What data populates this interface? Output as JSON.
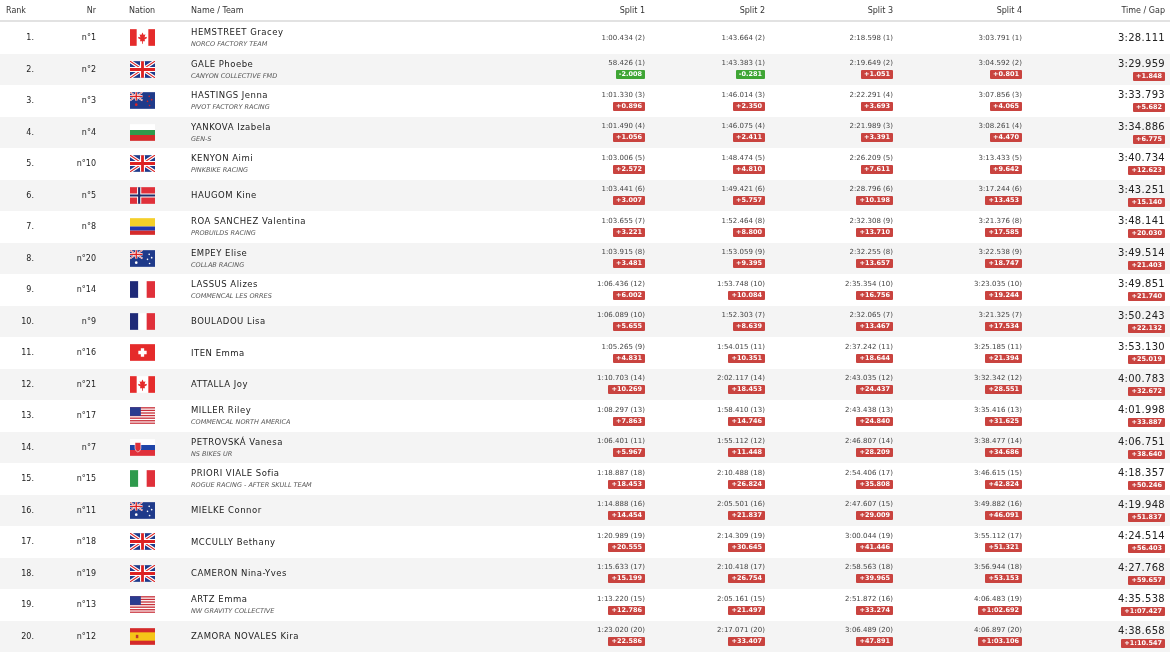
{
  "columns": [
    "Rank",
    "Nr",
    "Nation",
    "Name / Team",
    "Split 1",
    "Split 2",
    "Split 3",
    "Split 4",
    "Time / Gap"
  ],
  "rows": [
    {
      "rank": "1.",
      "nr": "n°1",
      "kind": "ca",
      "name": "HEMSTREET Gracey",
      "team": "NORCO FACTORY TEAM",
      "splits": [
        {
          "time": "1:00.434 (2)"
        },
        {
          "time": "1:43.664 (2)"
        },
        {
          "time": "2:18.598 (1)"
        },
        {
          "time": "3:03.791 (1)"
        }
      ],
      "time": "3:28.111"
    },
    {
      "rank": "2.",
      "nr": "n°2",
      "kind": "gb",
      "name": "GALE Phoebe",
      "team": "CANYON COLLECTIVE FMD",
      "splits": [
        {
          "time": "58.426 (1)",
          "gap": "-2.008",
          "ahead": true
        },
        {
          "time": "1:43.383 (1)",
          "gap": "-0.281",
          "ahead": true
        },
        {
          "time": "2:19.649 (2)",
          "gap": "+1.051",
          "ahead": false
        },
        {
          "time": "3:04.592 (2)",
          "gap": "+0.801",
          "ahead": false
        }
      ],
      "time": "3:29.959",
      "gap": "+1.848"
    },
    {
      "rank": "3.",
      "nr": "n°3",
      "kind": "nz",
      "name": "HASTINGS Jenna",
      "team": "PIVOT FACTORY RACING",
      "splits": [
        {
          "time": "1:01.330 (3)",
          "gap": "+0.896",
          "ahead": false
        },
        {
          "time": "1:46.014 (3)",
          "gap": "+2.350",
          "ahead": false
        },
        {
          "time": "2:22.291 (4)",
          "gap": "+3.693",
          "ahead": false
        },
        {
          "time": "3:07.856 (3)",
          "gap": "+4.065",
          "ahead": false
        }
      ],
      "time": "3:33.793",
      "gap": "+5.682"
    },
    {
      "rank": "4.",
      "nr": "n°4",
      "kind": "bg",
      "name": "YANKOVA Izabela",
      "team": "GEN-S",
      "splits": [
        {
          "time": "1:01.490 (4)",
          "gap": "+1.056",
          "ahead": false
        },
        {
          "time": "1:46.075 (4)",
          "gap": "+2.411",
          "ahead": false
        },
        {
          "time": "2:21.989 (3)",
          "gap": "+3.391",
          "ahead": false
        },
        {
          "time": "3:08.261 (4)",
          "gap": "+4.470",
          "ahead": false
        }
      ],
      "time": "3:34.886",
      "gap": "+6.775"
    },
    {
      "rank": "5.",
      "nr": "n°10",
      "kind": "gb",
      "name": "KENYON Aimi",
      "team": "PINKBIKE RACING",
      "splits": [
        {
          "time": "1:03.006 (5)",
          "gap": "+2.572",
          "ahead": false
        },
        {
          "time": "1:48.474 (5)",
          "gap": "+4.810",
          "ahead": false
        },
        {
          "time": "2:26.209 (5)",
          "gap": "+7.611",
          "ahead": false
        },
        {
          "time": "3:13.433 (5)",
          "gap": "+9.642",
          "ahead": false
        }
      ],
      "time": "3:40.734",
      "gap": "+12.623"
    },
    {
      "rank": "6.",
      "nr": "n°5",
      "kind": "no",
      "name": "HAUGOM Kine",
      "splits": [
        {
          "time": "1:03.441 (6)",
          "gap": "+3.007",
          "ahead": false
        },
        {
          "time": "1:49.421 (6)",
          "gap": "+5.757",
          "ahead": false
        },
        {
          "time": "2:28.796 (6)",
          "gap": "+10.198",
          "ahead": false
        },
        {
          "time": "3:17.244 (6)",
          "gap": "+13.453",
          "ahead": false
        }
      ],
      "time": "3:43.251",
      "gap": "+15.140"
    },
    {
      "rank": "7.",
      "nr": "n°8",
      "kind": "co",
      "name": "ROA SANCHEZ Valentina",
      "team": "PROBUILDS RACING",
      "splits": [
        {
          "time": "1:03.655 (7)",
          "gap": "+3.221",
          "ahead": false
        },
        {
          "time": "1:52.464 (8)",
          "gap": "+8.800",
          "ahead": false
        },
        {
          "time": "2:32.308 (9)",
          "gap": "+13.710",
          "ahead": false
        },
        {
          "time": "3:21.376 (8)",
          "gap": "+17.585",
          "ahead": false
        }
      ],
      "time": "3:48.141",
      "gap": "+20.030"
    },
    {
      "rank": "8.",
      "nr": "n°20",
      "kind": "au",
      "name": "EMPEY Elise",
      "team": "COLLAB RACING",
      "splits": [
        {
          "time": "1:03.915 (8)",
          "gap": "+3.481",
          "ahead": false
        },
        {
          "time": "1:53.059 (9)",
          "gap": "+9.395",
          "ahead": false
        },
        {
          "time": "2:32.255 (8)",
          "gap": "+13.657",
          "ahead": false
        },
        {
          "time": "3:22.538 (9)",
          "gap": "+18.747",
          "ahead": false
        }
      ],
      "time": "3:49.514",
      "gap": "+21.403"
    },
    {
      "rank": "9.",
      "nr": "n°14",
      "kind": "fr",
      "name": "LASSUS Alizes",
      "team": "COMMENCAL LES ORRES",
      "splits": [
        {
          "time": "1:06.436 (12)",
          "gap": "+6.002",
          "ahead": false
        },
        {
          "time": "1:53.748 (10)",
          "gap": "+10.084",
          "ahead": false
        },
        {
          "time": "2:35.354 (10)",
          "gap": "+16.756",
          "ahead": false
        },
        {
          "time": "3:23.035 (10)",
          "gap": "+19.244",
          "ahead": false
        }
      ],
      "time": "3:49.851",
      "gap": "+21.740"
    },
    {
      "rank": "10.",
      "nr": "n°9",
      "kind": "fr",
      "name": "BOULADOU Lisa",
      "splits": [
        {
          "time": "1:06.089 (10)",
          "gap": "+5.655",
          "ahead": false
        },
        {
          "time": "1:52.303 (7)",
          "gap": "+8.639",
          "ahead": false
        },
        {
          "time": "2:32.065 (7)",
          "gap": "+13.467",
          "ahead": false
        },
        {
          "time": "3:21.325 (7)",
          "gap": "+17.534",
          "ahead": false
        }
      ],
      "time": "3:50.243",
      "gap": "+22.132"
    },
    {
      "rank": "11.",
      "nr": "n°16",
      "kind": "ch",
      "name": "ITEN Emma",
      "splits": [
        {
          "time": "1:05.265 (9)",
          "gap": "+4.831",
          "ahead": false
        },
        {
          "time": "1:54.015 (11)",
          "gap": "+10.351",
          "ahead": false
        },
        {
          "time": "2:37.242 (11)",
          "gap": "+18.644",
          "ahead": false
        },
        {
          "time": "3:25.185 (11)",
          "gap": "+21.394",
          "ahead": false
        }
      ],
      "time": "3:53.130",
      "gap": "+25.019"
    },
    {
      "rank": "12.",
      "nr": "n°21",
      "kind": "ca",
      "name": "ATTALLA Joy",
      "splits": [
        {
          "time": "1:10.703 (14)",
          "gap": "+10.269",
          "ahead": false
        },
        {
          "time": "2:02.117 (14)",
          "gap": "+18.453",
          "ahead": false
        },
        {
          "time": "2:43.035 (12)",
          "gap": "+24.437",
          "ahead": false
        },
        {
          "time": "3:32.342 (12)",
          "gap": "+28.551",
          "ahead": false
        }
      ],
      "time": "4:00.783",
      "gap": "+32.672"
    },
    {
      "rank": "13.",
      "nr": "n°17",
      "kind": "us",
      "name": "MILLER Riley",
      "team": "COMMENCAL NORTH AMERICA",
      "splits": [
        {
          "time": "1:08.297 (13)",
          "gap": "+7.863",
          "ahead": false
        },
        {
          "time": "1:58.410 (13)",
          "gap": "+14.746",
          "ahead": false
        },
        {
          "time": "2:43.438 (13)",
          "gap": "+24.840",
          "ahead": false
        },
        {
          "time": "3:35.416 (13)",
          "gap": "+31.625",
          "ahead": false
        }
      ],
      "time": "4:01.998",
      "gap": "+33.887"
    },
    {
      "rank": "14.",
      "nr": "n°7",
      "kind": "sk",
      "name": "PETROVSKÁ Vanesa",
      "team": "NS BIKES UR",
      "splits": [
        {
          "time": "1:06.401 (11)",
          "gap": "+5.967",
          "ahead": false
        },
        {
          "time": "1:55.112 (12)",
          "gap": "+11.448",
          "ahead": false
        },
        {
          "time": "2:46.807 (14)",
          "gap": "+28.209",
          "ahead": false
        },
        {
          "time": "3:38.477 (14)",
          "gap": "+34.686",
          "ahead": false
        }
      ],
      "time": "4:06.751",
      "gap": "+38.640"
    },
    {
      "rank": "15.",
      "nr": "n°15",
      "kind": "it",
      "name": "PRIORI VIALE Sofia",
      "team": "ROGUE RACING - AFTER SKULL TEAM",
      "splits": [
        {
          "time": "1:18.887 (18)",
          "gap": "+18.453",
          "ahead": false
        },
        {
          "time": "2:10.488 (18)",
          "gap": "+26.824",
          "ahead": false
        },
        {
          "time": "2:54.406 (17)",
          "gap": "+35.808",
          "ahead": false
        },
        {
          "time": "3:46.615 (15)",
          "gap": "+42.824",
          "ahead": false
        }
      ],
      "time": "4:18.357",
      "gap": "+50.246"
    },
    {
      "rank": "16.",
      "nr": "n°11",
      "kind": "au",
      "name": "MIELKE Connor",
      "splits": [
        {
          "time": "1:14.888 (16)",
          "gap": "+14.454",
          "ahead": false
        },
        {
          "time": "2:05.501 (16)",
          "gap": "+21.837",
          "ahead": false
        },
        {
          "time": "2:47.607 (15)",
          "gap": "+29.009",
          "ahead": false
        },
        {
          "time": "3:49.882 (16)",
          "gap": "+46.091",
          "ahead": false
        }
      ],
      "time": "4:19.948",
      "gap": "+51.837"
    },
    {
      "rank": "17.",
      "nr": "n°18",
      "kind": "gb",
      "name": "MCCULLY Bethany",
      "splits": [
        {
          "time": "1:20.989 (19)",
          "gap": "+20.555",
          "ahead": false
        },
        {
          "time": "2:14.309 (19)",
          "gap": "+30.645",
          "ahead": false
        },
        {
          "time": "3:00.044 (19)",
          "gap": "+41.446",
          "ahead": false
        },
        {
          "time": "3:55.112 (17)",
          "gap": "+51.321",
          "ahead": false
        }
      ],
      "time": "4:24.514",
      "gap": "+56.403"
    },
    {
      "rank": "18.",
      "nr": "n°19",
      "kind": "gb",
      "name": "CAMERON Nina-Yves",
      "splits": [
        {
          "time": "1:15.633 (17)",
          "gap": "+15.199",
          "ahead": false
        },
        {
          "time": "2:10.418 (17)",
          "gap": "+26.754",
          "ahead": false
        },
        {
          "time": "2:58.563 (18)",
          "gap": "+39.965",
          "ahead": false
        },
        {
          "time": "3:56.944 (18)",
          "gap": "+53.153",
          "ahead": false
        }
      ],
      "time": "4:27.768",
      "gap": "+59.657"
    },
    {
      "rank": "19.",
      "nr": "n°13",
      "kind": "us",
      "name": "ARTZ Emma",
      "team": "NW GRAVITY COLLECTIVE",
      "splits": [
        {
          "time": "1:13.220 (15)",
          "gap": "+12.786",
          "ahead": false
        },
        {
          "time": "2:05.161 (15)",
          "gap": "+21.497",
          "ahead": false
        },
        {
          "time": "2:51.872 (16)",
          "gap": "+33.274",
          "ahead": false
        },
        {
          "time": "4:06.483 (19)",
          "gap": "+1:02.692",
          "ahead": false
        }
      ],
      "time": "4:35.538",
      "gap": "+1:07.427"
    },
    {
      "rank": "20.",
      "nr": "n°12",
      "kind": "es",
      "name": "ZAMORA NOVALES Kira",
      "splits": [
        {
          "time": "1:23.020 (20)",
          "gap": "+22.586",
          "ahead": false
        },
        {
          "time": "2:17.071 (20)",
          "gap": "+33.407",
          "ahead": false
        },
        {
          "time": "3:06.489 (20)",
          "gap": "+47.891",
          "ahead": false
        },
        {
          "time": "4:06.897 (20)",
          "gap": "+1:03.106",
          "ahead": false
        }
      ],
      "time": "4:38.658",
      "gap": "+1:10.547"
    }
  ]
}
